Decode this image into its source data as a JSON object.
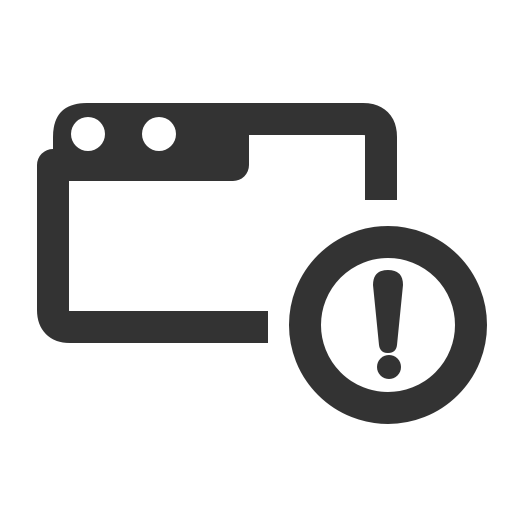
{
  "icon": {
    "name": "browser-window-warning-icon",
    "parts": {
      "window": "browser-window-icon",
      "alert": "exclamation-warning-icon"
    },
    "colors": {
      "glyph": "#333333",
      "background": "#ffffff"
    }
  }
}
